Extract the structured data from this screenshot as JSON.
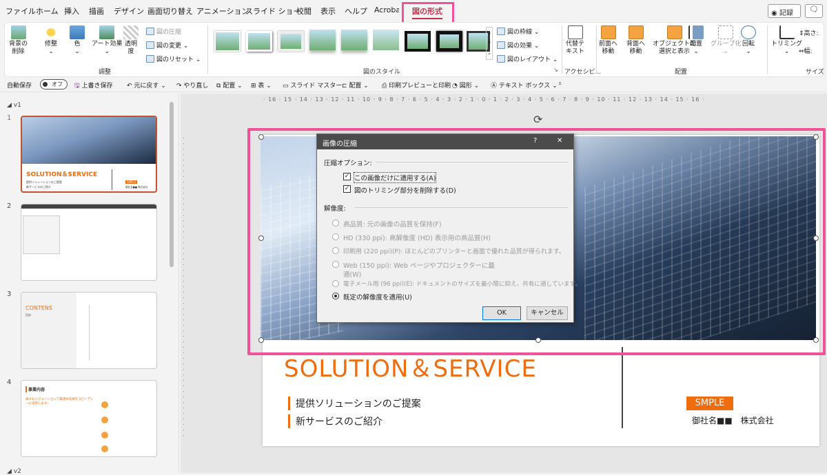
{
  "tabs": [
    "ファイル",
    "ホーム",
    "挿入",
    "描画",
    "デザイン",
    "画面切り替え",
    "アニメーション",
    "スライド ショー",
    "校閲",
    "表示",
    "ヘルプ",
    "Acrobat",
    "図の形式"
  ],
  "right_buttons": {
    "record": "記録"
  },
  "ribbon": {
    "adjust": {
      "remove_bg": "背景の\n削除",
      "corrections": "修整",
      "color": "色",
      "artistic": "アート効果",
      "transparency": "透明\n度",
      "compress": "図の圧縮",
      "change": "図の変更",
      "reset": "図のリセット",
      "group_label": "調整"
    },
    "styles": {
      "group_label": "図のスタイル",
      "border": "図の枠線",
      "effects": "図の効果",
      "layout": "図のレイアウト"
    },
    "accessibility": {
      "alt_text": "代替テ\nキスト",
      "group_label": "アクセシビ..."
    },
    "arrange": {
      "forward": "前面へ\n移動",
      "backward": "背面へ\n移動",
      "selection": "オブジェクトの\n選択と表示",
      "align": "配置",
      "group": "グループ化",
      "rotate": "回転",
      "group_label": "配置"
    },
    "size": {
      "crop": "トリミング",
      "height": "高さ:",
      "width": "幅:",
      "group_label": "サイズ"
    }
  },
  "qat": {
    "autosave": "自動保存",
    "autosave_state": "オフ",
    "save": "上書き保存",
    "undo": "元に戻す",
    "redo": "やり直し",
    "arrange1": "配置",
    "table": "表",
    "slide_master": "スライド マスター",
    "arrange2": "配置",
    "print_preview": "印刷プレビューと印刷",
    "shapes": "図形",
    "textbox": "テキスト ボックス"
  },
  "thumbs": {
    "section1": "v1",
    "section2": "v2",
    "slides": [
      {
        "num": "1",
        "title": "SOLUTION＆SERVICE",
        "line1": "提供ソリューションのご提案",
        "line2": "新サービスのご紹介",
        "badge": "SMPLE",
        "company": "御社名■■ 株式会社"
      },
      {
        "num": "2"
      },
      {
        "num": "3",
        "title": "CONTENS",
        "sub": "目次"
      },
      {
        "num": "4",
        "title": "事業内容",
        "sub": "様々なソリューションで最適の効果をスピーディーに実現します。"
      }
    ]
  },
  "ruler": {
    "h": "· 16 · 15 · 14 · 13 · 12 · 11 · 10 · 9 · 8 · 7 · 6 · 5 · 4 · 3 · 2 · 1 · 0 · 1 · 2 · 3 · 4 · 5 · 6 · 7 · 8 · 9 · 10 · 11 · 12 · 13 · 14 · 15 · 16 ·"
  },
  "slide": {
    "title": "SOLUTION＆SERVICE",
    "line1": "提供ソリューションのご提案",
    "line2": "新サービスのご紹介",
    "badge": "SMPLE",
    "company": "御社名■■　株式会社"
  },
  "dialog": {
    "title": "画像の圧縮",
    "help": "?",
    "close": "✕",
    "options_header": "圧縮オプション:",
    "opt1": "この画像だけに適用する(A)",
    "opt2": "図のトリミング部分を削除する(D)",
    "res_header": "解像度:",
    "res": [
      {
        "label": "高品質: 元の画像の品質を保持(F)",
        "selected": false,
        "enabled": false
      },
      {
        "label": "HD (330 ppi): 高解像度 (HD) 表示用の高品質(H)",
        "selected": false,
        "enabled": false
      },
      {
        "label": "印刷用 (220 ppi)(P): ほとんどのプリンターと画面で優れた品質が得られます。",
        "selected": false,
        "enabled": false
      },
      {
        "label": "Web (150 ppi): Web ページやプロジェクターに最",
        "label2": "適(W)",
        "selected": false,
        "enabled": false
      },
      {
        "label": "電子メール用 (96 ppi)(E): ドキュメントのサイズを最小限に抑え、共有に適しています。",
        "selected": false,
        "enabled": false
      },
      {
        "label": "既定の解像度を適用(U)",
        "selected": true,
        "enabled": true
      }
    ],
    "ok": "OK",
    "cancel": "キャンセル"
  },
  "colors": {
    "accent": "#f0529a",
    "brand_orange": "#ef6c0f",
    "thumb_select": "#c4522a"
  }
}
